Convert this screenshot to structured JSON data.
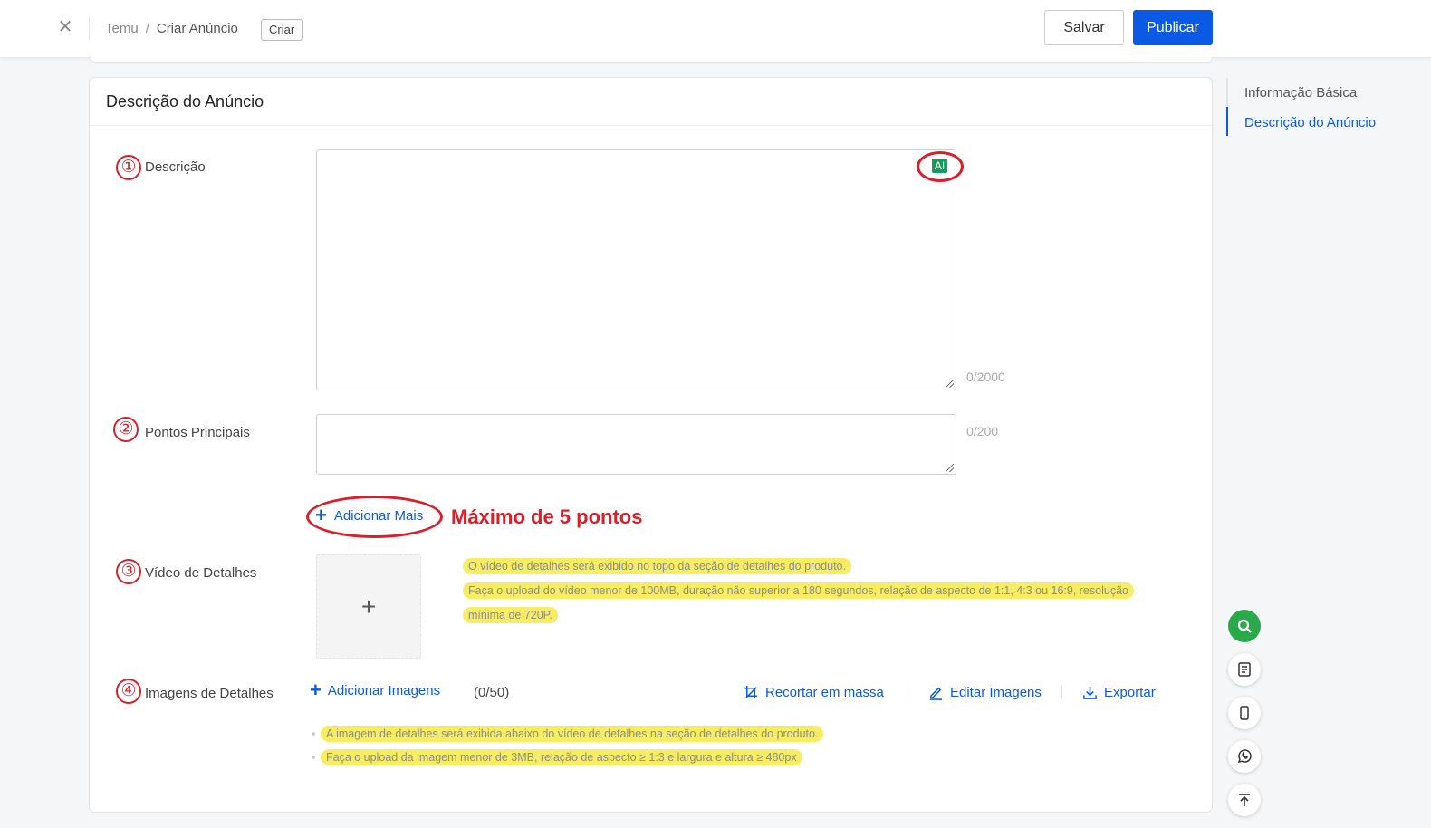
{
  "header": {
    "breadcrumb": [
      "Temu",
      "/",
      "Criar Anúncio"
    ],
    "status_tag": "Criar",
    "save_label": "Salvar",
    "publish_label": "Publicar"
  },
  "card": {
    "title": "Descrição do Anúncio"
  },
  "fields": {
    "description": {
      "number": "①",
      "label": "Descrição",
      "ai_badge": "AI",
      "value": "",
      "counter": "0/2000"
    },
    "bullet_points": {
      "number": "②",
      "label": "Pontos Principais",
      "value": "",
      "counter": "0/200",
      "add_more_label": "Adicionar Mais",
      "annotation": "Máximo de 5 pontos"
    },
    "detail_video": {
      "number": "③",
      "label": "Vídeo de Detalhes",
      "upload_symbol": "+",
      "hint_1": "O vídeo de detalhes será exibido no topo da seção de detalhes do produto.",
      "hint_2a": "Faça o upload do vídeo menor de 100MB, duração não superior a 180 segundos, relação de aspecto de 1:1, 4:3 ou 16:9, resolução",
      "hint_2b": "mínima de 720P."
    },
    "detail_images": {
      "number": "④",
      "label": "Imagens de Detalhes",
      "add_images_label": "Adicionar Imagens",
      "count": "(0/50)",
      "bulk_crop_label": "Recortar em massa",
      "edit_images_label": "Editar Imagens",
      "export_label": "Exportar",
      "hint_1": "A imagem de detalhes será exibida abaixo do vídeo de detalhes na seção de detalhes do produto.",
      "hint_2": "Faça o upload da imagem menor de 3MB, relação de aspecto ≥ 1:3 e largura e altura ≥ 480px"
    }
  },
  "toc": {
    "items": [
      "Informação Básica",
      "Descrição do Anúncio"
    ],
    "active": "Descrição do Anúncio"
  },
  "floating_tools": [
    "search-icon",
    "form-icon",
    "mobile-icon",
    "whatsapp-icon",
    "back-to-top-icon"
  ],
  "colors": {
    "primary": "#0a5ae6",
    "annotation_red": "#d9202a",
    "highlight_yellow": "#f6ed63",
    "ai_green": "#169a5c",
    "search_green": "#2aa84a"
  }
}
